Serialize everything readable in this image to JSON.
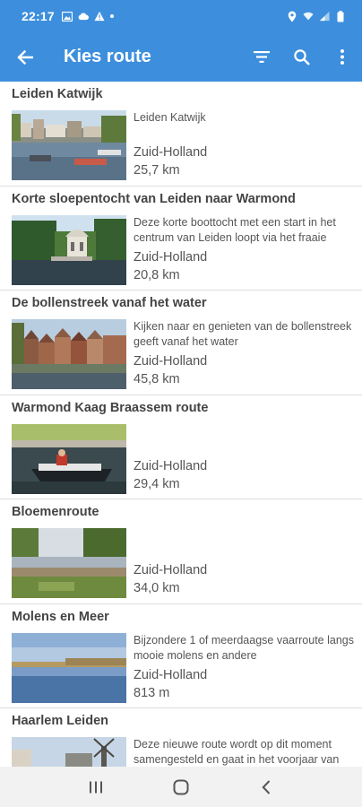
{
  "status_bar": {
    "time": "22:17",
    "icons_left": [
      "image-icon",
      "cloud-icon",
      "warning-icon",
      "dot-icon"
    ],
    "icons_right": [
      "location-icon",
      "wifi-icon",
      "signal-icon",
      "battery-icon"
    ]
  },
  "app_bar": {
    "title": "Kies route",
    "back_icon": "arrow-left-icon",
    "actions": [
      "filter-icon",
      "search-icon",
      "more-vert-icon"
    ]
  },
  "colors": {
    "primary": "#3d8fdd",
    "text_title": "#444444",
    "text_body": "#555555",
    "divider": "#dddddd"
  },
  "routes": [
    {
      "title": "Leiden Katwijk",
      "description": "Leiden Katwijk",
      "region": "Zuid-Holland",
      "distance": "25,7 km",
      "image": "harbor-boats"
    },
    {
      "title": "Korte sloepentocht van Leiden naar Warmond",
      "description": "Deze korte boottocht met een start in het centrum van Leiden loopt via het fraaie",
      "region": "Zuid-Holland",
      "distance": "20,8 km",
      "image": "pavilion-water"
    },
    {
      "title": "De bollenstreek vanaf het water",
      "description": "Kijken naar en genieten van de bollenstreek geeft vanaf het water",
      "region": "Zuid-Holland",
      "distance": "45,8 km",
      "image": "canal-houses"
    },
    {
      "title": "Warmond Kaag Braassem route",
      "description": "",
      "region": "Zuid-Holland",
      "distance": "29,4 km",
      "image": "sloop-boat"
    },
    {
      "title": "Bloemenroute",
      "description": "",
      "region": "Zuid-Holland",
      "distance": "34,0 km",
      "image": "lake-tree"
    },
    {
      "title": "Molens en Meer",
      "description": "Bijzondere 1 of meerdaagse vaarroute langs mooie molens en andere",
      "region": "Zuid-Holland",
      "distance": "813 m",
      "image": "calm-lake"
    },
    {
      "title": "Haarlem Leiden",
      "description": "Deze nieuwe route wordt op dit moment samengesteld en gaat in het voorjaar van",
      "region": "",
      "distance": "",
      "image": "windmill-sky"
    }
  ],
  "nav_bar": {
    "buttons": [
      "recents-icon",
      "home-icon",
      "back-icon"
    ]
  }
}
